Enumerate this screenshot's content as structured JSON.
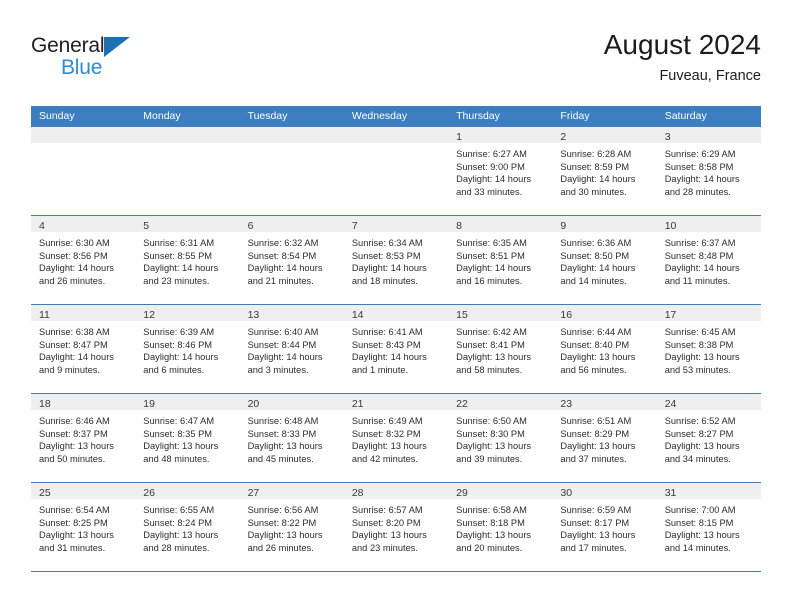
{
  "brand": {
    "name_part1": "General",
    "name_part2": "Blue",
    "triangle_color": "#1f6fb5",
    "blue_color": "#2e8bd4"
  },
  "header": {
    "title": "August 2024",
    "subtitle": "Fuveau, France"
  },
  "theme": {
    "header_band": "#3c7ebf",
    "day_band": "#efefef",
    "row_divider": "#3c7ebf",
    "text": "#2d2d2d"
  },
  "calendar": {
    "day_headers": [
      "Sunday",
      "Monday",
      "Tuesday",
      "Wednesday",
      "Thursday",
      "Friday",
      "Saturday"
    ],
    "weeks": [
      [
        {
          "day": "",
          "sunrise": "",
          "sunset": "",
          "daylight_line1": "",
          "daylight_line2": ""
        },
        {
          "day": "",
          "sunrise": "",
          "sunset": "",
          "daylight_line1": "",
          "daylight_line2": ""
        },
        {
          "day": "",
          "sunrise": "",
          "sunset": "",
          "daylight_line1": "",
          "daylight_line2": ""
        },
        {
          "day": "",
          "sunrise": "",
          "sunset": "",
          "daylight_line1": "",
          "daylight_line2": ""
        },
        {
          "day": "1",
          "sunrise": "Sunrise: 6:27 AM",
          "sunset": "Sunset: 9:00 PM",
          "daylight_line1": "Daylight: 14 hours",
          "daylight_line2": "and 33 minutes."
        },
        {
          "day": "2",
          "sunrise": "Sunrise: 6:28 AM",
          "sunset": "Sunset: 8:59 PM",
          "daylight_line1": "Daylight: 14 hours",
          "daylight_line2": "and 30 minutes."
        },
        {
          "day": "3",
          "sunrise": "Sunrise: 6:29 AM",
          "sunset": "Sunset: 8:58 PM",
          "daylight_line1": "Daylight: 14 hours",
          "daylight_line2": "and 28 minutes."
        }
      ],
      [
        {
          "day": "4",
          "sunrise": "Sunrise: 6:30 AM",
          "sunset": "Sunset: 8:56 PM",
          "daylight_line1": "Daylight: 14 hours",
          "daylight_line2": "and 26 minutes."
        },
        {
          "day": "5",
          "sunrise": "Sunrise: 6:31 AM",
          "sunset": "Sunset: 8:55 PM",
          "daylight_line1": "Daylight: 14 hours",
          "daylight_line2": "and 23 minutes."
        },
        {
          "day": "6",
          "sunrise": "Sunrise: 6:32 AM",
          "sunset": "Sunset: 8:54 PM",
          "daylight_line1": "Daylight: 14 hours",
          "daylight_line2": "and 21 minutes."
        },
        {
          "day": "7",
          "sunrise": "Sunrise: 6:34 AM",
          "sunset": "Sunset: 8:53 PM",
          "daylight_line1": "Daylight: 14 hours",
          "daylight_line2": "and 18 minutes."
        },
        {
          "day": "8",
          "sunrise": "Sunrise: 6:35 AM",
          "sunset": "Sunset: 8:51 PM",
          "daylight_line1": "Daylight: 14 hours",
          "daylight_line2": "and 16 minutes."
        },
        {
          "day": "9",
          "sunrise": "Sunrise: 6:36 AM",
          "sunset": "Sunset: 8:50 PM",
          "daylight_line1": "Daylight: 14 hours",
          "daylight_line2": "and 14 minutes."
        },
        {
          "day": "10",
          "sunrise": "Sunrise: 6:37 AM",
          "sunset": "Sunset: 8:48 PM",
          "daylight_line1": "Daylight: 14 hours",
          "daylight_line2": "and 11 minutes."
        }
      ],
      [
        {
          "day": "11",
          "sunrise": "Sunrise: 6:38 AM",
          "sunset": "Sunset: 8:47 PM",
          "daylight_line1": "Daylight: 14 hours",
          "daylight_line2": "and 9 minutes."
        },
        {
          "day": "12",
          "sunrise": "Sunrise: 6:39 AM",
          "sunset": "Sunset: 8:46 PM",
          "daylight_line1": "Daylight: 14 hours",
          "daylight_line2": "and 6 minutes."
        },
        {
          "day": "13",
          "sunrise": "Sunrise: 6:40 AM",
          "sunset": "Sunset: 8:44 PM",
          "daylight_line1": "Daylight: 14 hours",
          "daylight_line2": "and 3 minutes."
        },
        {
          "day": "14",
          "sunrise": "Sunrise: 6:41 AM",
          "sunset": "Sunset: 8:43 PM",
          "daylight_line1": "Daylight: 14 hours",
          "daylight_line2": "and 1 minute."
        },
        {
          "day": "15",
          "sunrise": "Sunrise: 6:42 AM",
          "sunset": "Sunset: 8:41 PM",
          "daylight_line1": "Daylight: 13 hours",
          "daylight_line2": "and 58 minutes."
        },
        {
          "day": "16",
          "sunrise": "Sunrise: 6:44 AM",
          "sunset": "Sunset: 8:40 PM",
          "daylight_line1": "Daylight: 13 hours",
          "daylight_line2": "and 56 minutes."
        },
        {
          "day": "17",
          "sunrise": "Sunrise: 6:45 AM",
          "sunset": "Sunset: 8:38 PM",
          "daylight_line1": "Daylight: 13 hours",
          "daylight_line2": "and 53 minutes."
        }
      ],
      [
        {
          "day": "18",
          "sunrise": "Sunrise: 6:46 AM",
          "sunset": "Sunset: 8:37 PM",
          "daylight_line1": "Daylight: 13 hours",
          "daylight_line2": "and 50 minutes."
        },
        {
          "day": "19",
          "sunrise": "Sunrise: 6:47 AM",
          "sunset": "Sunset: 8:35 PM",
          "daylight_line1": "Daylight: 13 hours",
          "daylight_line2": "and 48 minutes."
        },
        {
          "day": "20",
          "sunrise": "Sunrise: 6:48 AM",
          "sunset": "Sunset: 8:33 PM",
          "daylight_line1": "Daylight: 13 hours",
          "daylight_line2": "and 45 minutes."
        },
        {
          "day": "21",
          "sunrise": "Sunrise: 6:49 AM",
          "sunset": "Sunset: 8:32 PM",
          "daylight_line1": "Daylight: 13 hours",
          "daylight_line2": "and 42 minutes."
        },
        {
          "day": "22",
          "sunrise": "Sunrise: 6:50 AM",
          "sunset": "Sunset: 8:30 PM",
          "daylight_line1": "Daylight: 13 hours",
          "daylight_line2": "and 39 minutes."
        },
        {
          "day": "23",
          "sunrise": "Sunrise: 6:51 AM",
          "sunset": "Sunset: 8:29 PM",
          "daylight_line1": "Daylight: 13 hours",
          "daylight_line2": "and 37 minutes."
        },
        {
          "day": "24",
          "sunrise": "Sunrise: 6:52 AM",
          "sunset": "Sunset: 8:27 PM",
          "daylight_line1": "Daylight: 13 hours",
          "daylight_line2": "and 34 minutes."
        }
      ],
      [
        {
          "day": "25",
          "sunrise": "Sunrise: 6:54 AM",
          "sunset": "Sunset: 8:25 PM",
          "daylight_line1": "Daylight: 13 hours",
          "daylight_line2": "and 31 minutes."
        },
        {
          "day": "26",
          "sunrise": "Sunrise: 6:55 AM",
          "sunset": "Sunset: 8:24 PM",
          "daylight_line1": "Daylight: 13 hours",
          "daylight_line2": "and 28 minutes."
        },
        {
          "day": "27",
          "sunrise": "Sunrise: 6:56 AM",
          "sunset": "Sunset: 8:22 PM",
          "daylight_line1": "Daylight: 13 hours",
          "daylight_line2": "and 26 minutes."
        },
        {
          "day": "28",
          "sunrise": "Sunrise: 6:57 AM",
          "sunset": "Sunset: 8:20 PM",
          "daylight_line1": "Daylight: 13 hours",
          "daylight_line2": "and 23 minutes."
        },
        {
          "day": "29",
          "sunrise": "Sunrise: 6:58 AM",
          "sunset": "Sunset: 8:18 PM",
          "daylight_line1": "Daylight: 13 hours",
          "daylight_line2": "and 20 minutes."
        },
        {
          "day": "30",
          "sunrise": "Sunrise: 6:59 AM",
          "sunset": "Sunset: 8:17 PM",
          "daylight_line1": "Daylight: 13 hours",
          "daylight_line2": "and 17 minutes."
        },
        {
          "day": "31",
          "sunrise": "Sunrise: 7:00 AM",
          "sunset": "Sunset: 8:15 PM",
          "daylight_line1": "Daylight: 13 hours",
          "daylight_line2": "and 14 minutes."
        }
      ]
    ]
  }
}
